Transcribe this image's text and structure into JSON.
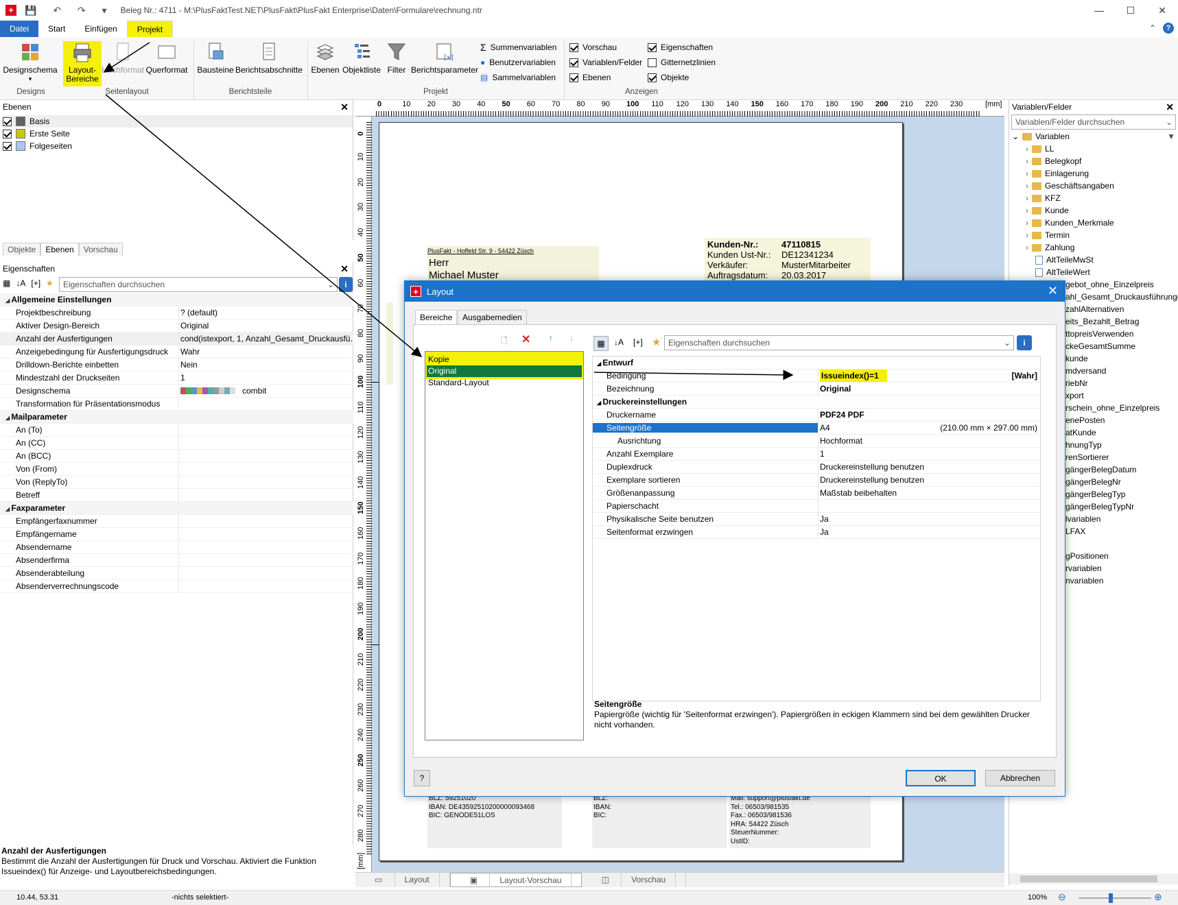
{
  "window": {
    "title": "Beleg Nr.: 4711 - M:\\PlusFaktTest.NET\\PlusFakt\\PlusFakt Enterprise\\Daten\\Formulare\\rechnung.ntr",
    "quick_access": "💾 ↶ ↷ ▾",
    "controls": {
      "minimize": "—",
      "maximize": "☐",
      "close": "✕"
    }
  },
  "menu": {
    "tabs": [
      "Datei",
      "Start",
      "Einfügen",
      "Projekt"
    ],
    "active_tab": "Projekt",
    "collapse": "⌃",
    "help": "?"
  },
  "ribbon": {
    "buttons": {
      "designschema": "Designschema",
      "layout_bereiche": "Layout-\nBereiche",
      "hochformat": "Hochformat",
      "querformat": "Querformat",
      "bausteine": "Bausteine",
      "berichtsabschnitte": "Berichtsabschnitte",
      "ebenen": "Ebenen",
      "objektliste": "Objektliste",
      "filter": "Filter",
      "berichtsparameter": "Berichtsparameter",
      "summenvariablen": "Summenvariablen",
      "benutzervariablen": "Benutzervariablen",
      "sammelvariablen": "Sammelvariablen"
    },
    "groups": {
      "designs": "Designs",
      "seitenlayout": "Seitenlayout",
      "berichtsteile": "Berichtsteile",
      "projekt": "Projekt",
      "anzeigen": "Anzeigen"
    },
    "checks": [
      {
        "label": "Vorschau",
        "checked": true
      },
      {
        "label": "Variablen/Felder",
        "checked": true
      },
      {
        "label": "Ebenen",
        "checked": true
      },
      {
        "label": "Eigenschaften",
        "checked": true
      },
      {
        "label": "Gitternetzlinien",
        "checked": false
      },
      {
        "label": "Objekte",
        "checked": true
      }
    ]
  },
  "layers_panel": {
    "title": "Ebenen",
    "items": [
      {
        "label": "Basis",
        "color": "#606060",
        "checked": true
      },
      {
        "label": "Erste Seite",
        "color": "#c8c800",
        "checked": true
      },
      {
        "label": "Folgeseiten",
        "color": "#a8c8f0",
        "checked": true
      }
    ],
    "tabs": [
      "Objekte",
      "Ebenen",
      "Vorschau"
    ]
  },
  "props_panel": {
    "title": "Eigenschaften",
    "search_placeholder": "Eigenschaften durchsuchen",
    "rows": [
      {
        "k": "Allgemeine Einstellungen",
        "v": "",
        "sec": true
      },
      {
        "k": "Projektbeschreibung",
        "v": "? (default)"
      },
      {
        "k": "Aktiver Design-Bereich",
        "v": "Original"
      },
      {
        "k": "Anzahl der Ausfertigungen",
        "v": "cond(istexport, 1, Anzahl_Gesamt_Druckausfü...",
        "hl": true
      },
      {
        "k": "Anzeigebedingung für Ausfertigungsdruck",
        "v": "Wahr"
      },
      {
        "k": "Drilldown-Berichte einbetten",
        "v": "Nein"
      },
      {
        "k": "Mindestzahl der Druckseiten",
        "v": "1"
      },
      {
        "k": "Designschema",
        "v": "combit",
        "swatch": true
      },
      {
        "k": "Transformation für Präsentationsmodus",
        "v": ""
      },
      {
        "k": "Mailparameter",
        "v": "",
        "sec": true
      },
      {
        "k": "An (To)",
        "v": ""
      },
      {
        "k": "An (CC)",
        "v": ""
      },
      {
        "k": "An (BCC)",
        "v": ""
      },
      {
        "k": "Von (From)",
        "v": ""
      },
      {
        "k": "Von (ReplyTo)",
        "v": ""
      },
      {
        "k": "Betreff",
        "v": ""
      },
      {
        "k": "Faxparameter",
        "v": "",
        "sec": true
      },
      {
        "k": "Empfängerfaxnummer",
        "v": ""
      },
      {
        "k": "Empfängername",
        "v": ""
      },
      {
        "k": "Absendername",
        "v": ""
      },
      {
        "k": "Absenderfirma",
        "v": ""
      },
      {
        "k": "Absenderabteilung",
        "v": ""
      },
      {
        "k": "Absenderverrechnungscode",
        "v": ""
      }
    ],
    "desc_title": "Anzahl der Ausfertigungen",
    "desc_text": "Bestimmt die Anzahl der Ausfertigungen für Druck und Vorschau. Aktiviert die Funktion Issueindex() für Anzeige- und Layoutbereichsbedingungen."
  },
  "ruler": {
    "unit": "[mm]",
    "top": [
      "0",
      "10",
      "20",
      "30",
      "40",
      "50",
      "60",
      "70",
      "80",
      "90",
      "100",
      "110",
      "120",
      "130",
      "140",
      "150",
      "160",
      "170",
      "180",
      "190",
      "200",
      "210",
      "220",
      "230"
    ],
    "left": [
      "0",
      "10",
      "20",
      "30",
      "40",
      "50",
      "60",
      "70",
      "80",
      "90",
      "100",
      "110",
      "120",
      "130",
      "140",
      "150",
      "160",
      "170",
      "180",
      "190",
      "200",
      "210",
      "220",
      "230",
      "240",
      "250",
      "260",
      "270",
      "280"
    ],
    "left_unit": "[mm]"
  },
  "document": {
    "sender_line": "PlusFakt - Hoffeld Str. 9 - 54422 Züsch",
    "salutation": "Herr",
    "name": "Michael Muster",
    "info": [
      {
        "k": "Kunden-Nr.:",
        "v": "47110815",
        "bold": true
      },
      {
        "k": "Kunden Ust-Nr.:",
        "v": "DE12341234"
      },
      {
        "k": "Verkäufer:",
        "v": "MusterMitarbeiter"
      },
      {
        "k": "Auftragsdatum:",
        "v": "20.03.2017"
      }
    ],
    "footer_bank": [
      "BLZ: 59251020",
      "IBAN: DE43592510200000093468",
      "BIC: GENODE51LOS"
    ],
    "footer_bank2": [
      "BLZ:",
      "IBAN:",
      "BIC:"
    ],
    "footer_contact": [
      "Mail: support@plusfakt.de",
      "Tel.: 06503/981535",
      "Fax.: 06503/981536",
      "HRA: 54422 Züsch",
      "SteuerNummer:",
      "UstID:"
    ]
  },
  "canvas_tabs": [
    "Layout",
    "Layout-Vorschau",
    "Vorschau"
  ],
  "vars_panel": {
    "title": "Variablen/Felder",
    "search_placeholder": "Variablen/Felder durchsuchen",
    "root": "Variablen",
    "folders": [
      "LL",
      "Belegkopf",
      "Einlagerung",
      "Geschäftsangaben",
      "KFZ",
      "Kunde",
      "Kunden_Merkmale",
      "Termin",
      "Zahlung"
    ],
    "items": [
      "AltTeileMwSt",
      "AltTeileWert",
      "gebot_ohne_Einzelpreis",
      "ahl_Gesamt_Druckausführunge",
      "zahlAlternativen",
      "eits_Bezahlt_Betrag",
      "ttopreisVerwenden",
      "ckeGesamtSumme",
      "kunde",
      "mdversand",
      "riebNr",
      "xport",
      "rschein_ohne_Einzelpreis",
      "enePosten",
      "atKunde",
      "hnungTyp",
      "renSortierer",
      "gängerBelegDatum",
      "gängerBelegNr",
      "gängerBelegTyp",
      "gängerBelegTypNr",
      "lvariablen",
      "LFAX",
      "",
      "gPositionen",
      "rvariablen",
      "nvariablen"
    ]
  },
  "status": {
    "coords": "10.44, 53.31",
    "selection": "-nichts selektiert-",
    "zoom": "100%"
  },
  "dialog": {
    "title": "Layout",
    "tabs": [
      "Bereiche",
      "Ausgabemedien"
    ],
    "list": [
      "Kopie",
      "Original",
      "Standard-Layout"
    ],
    "search_placeholder": "Eigenschaften durchsuchen",
    "rows": [
      {
        "k": "Entwurf",
        "v": "",
        "sec": true
      },
      {
        "k": "Bedingung",
        "v": "Issueindex()=1",
        "extra": "[Wahr]",
        "bold": true
      },
      {
        "k": "Bezeichnung",
        "v": "Original",
        "bold": true
      },
      {
        "k": "Druckereinstellungen",
        "v": "",
        "sec": true
      },
      {
        "k": "Druckername",
        "v": "PDF24 PDF",
        "bold": true
      },
      {
        "k": "Seitengröße",
        "v": "A4",
        "extra": "(210.00 mm × 297.00 mm)",
        "sel": true,
        "sub": true
      },
      {
        "k": "Ausrichtung",
        "v": "Hochformat",
        "indent": true
      },
      {
        "k": "Anzahl Exemplare",
        "v": "1"
      },
      {
        "k": "Duplexdruck",
        "v": "Druckereinstellung benutzen"
      },
      {
        "k": "Exemplare sortieren",
        "v": "Druckereinstellung benutzen"
      },
      {
        "k": "Größenanpassung",
        "v": "Maßstab beibehalten"
      },
      {
        "k": "Papierschacht",
        "v": ""
      },
      {
        "k": "Physikalische Seite benutzen",
        "v": "Ja"
      },
      {
        "k": "Seitenformat erzwingen",
        "v": "Ja"
      }
    ],
    "desc_title": "Seitengröße",
    "desc_text": "Papiergröße (wichtig für 'Seitenformat erzwingen'). Papiergrößen in eckigen Klammern sind bei dem gewählten Drucker nicht vorhanden.",
    "ok": "OK",
    "cancel": "Abbrechen",
    "help": "?"
  }
}
